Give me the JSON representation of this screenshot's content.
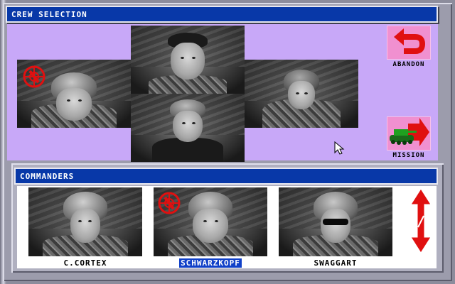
{
  "window": {
    "title": "CREW SELECTION"
  },
  "crew_slots": [
    {
      "slot": "commander",
      "has_insignia": true
    },
    {
      "slot": "gunner",
      "has_insignia": false
    },
    {
      "slot": "driver",
      "has_insignia": false
    },
    {
      "slot": "loader",
      "has_insignia": false
    }
  ],
  "actions": {
    "abandon_label": "ABANDON",
    "mission_label": "MISSION"
  },
  "commanders": {
    "title": "COMMANDERS",
    "roster": [
      {
        "name": "C.CORTEX",
        "selected": false,
        "has_insignia": false
      },
      {
        "name": "SCHWARZKOPF",
        "selected": true,
        "has_insignia": true
      },
      {
        "name": "SWAGGART",
        "selected": false,
        "has_insignia": false,
        "sunglasses": true
      }
    ]
  },
  "colors": {
    "title_bar": "#0838a8",
    "panel_bg": "#c8a8f8",
    "button_bg": "#f090d0",
    "accent_red": "#e01010",
    "tank_green": "#20a020",
    "selection_highlight": "#1040c8"
  },
  "icons": {
    "abandon": "u-turn-arrow-icon",
    "mission": "tank-arrow-icon",
    "scroll": "double-arrow-icon",
    "insignia": "star-insignia-icon",
    "cursor": "mouse-pointer-icon"
  }
}
